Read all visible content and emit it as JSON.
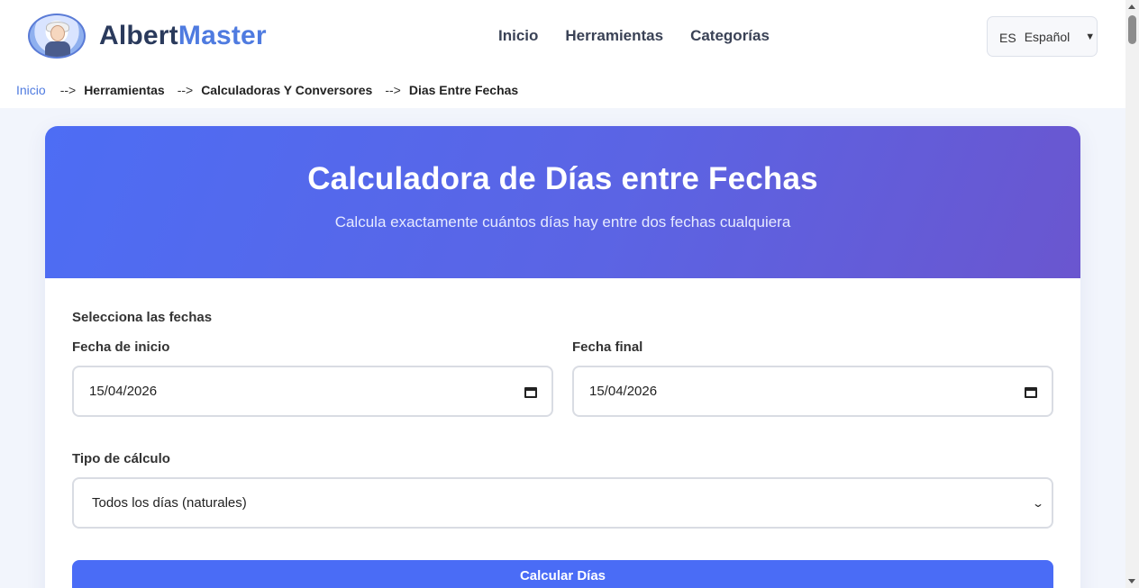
{
  "header": {
    "logo_part1": "Albert",
    "logo_part2": "Master",
    "nav": [
      "Inicio",
      "Herramientas",
      "Categorías"
    ],
    "language_code": "ES",
    "language_name": "Español",
    "language_caret": "▼"
  },
  "breadcrumb": {
    "home": "Inicio",
    "separator": "-->",
    "items": [
      "Herramientas",
      "Calculadoras Y Conversores",
      "Dias Entre Fechas"
    ]
  },
  "hero": {
    "title": "Calculadora de Días entre Fechas",
    "subtitle": "Calcula exactamente cuántos días hay entre dos fechas cualquiera"
  },
  "form": {
    "section_label": "Selecciona las fechas",
    "start_label": "Fecha de inicio",
    "start_value": "15/04/2026",
    "end_label": "Fecha final",
    "end_value": "15/04/2026",
    "type_label": "Tipo de cálculo",
    "type_selected": "Todos los días (naturales)",
    "submit_label": "Calcular Días"
  },
  "colors": {
    "primary": "#4a6cf6",
    "hero_start": "#4d6df4",
    "hero_end": "#6a56cf",
    "logo_accent": "#4f7be0"
  }
}
